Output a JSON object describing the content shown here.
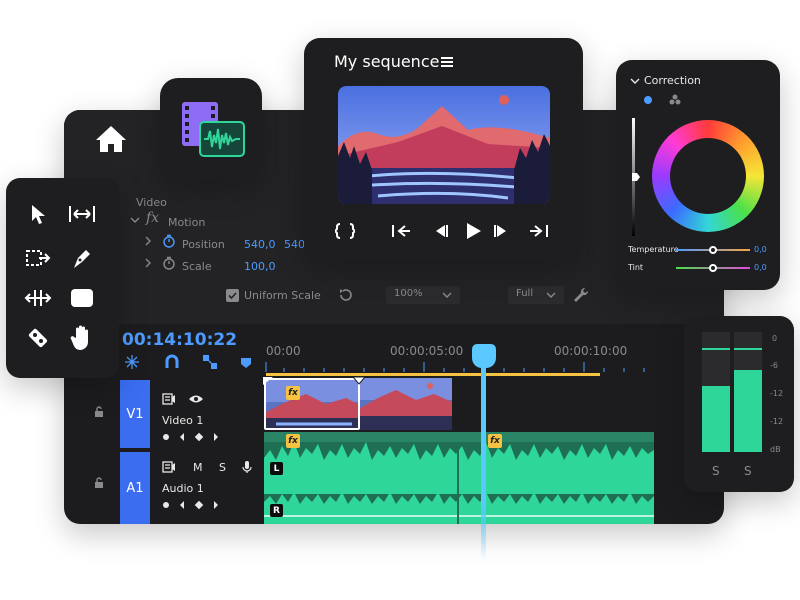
{
  "effects": {
    "section": "Video",
    "fx_label": "fx",
    "motion_label": "Motion",
    "position_label": "Position",
    "position_x": "540,0",
    "position_y": "540,",
    "scale_label": "Scale",
    "scale_value": "100,0",
    "uniform_scale_label": "Uniform Scale",
    "zoom_value": "100%",
    "quality_value": "Full"
  },
  "timeline": {
    "timecode": "00:14:10:22",
    "ruler_ticks": [
      "00:00",
      "00:00:05:00",
      "00:00:10:00"
    ],
    "tracks": [
      {
        "id": "V1",
        "name": "Video 1"
      },
      {
        "id": "A1",
        "name": "Audio 1",
        "mute": "M",
        "solo": "S"
      }
    ],
    "fx_badge": "fx",
    "channel_left": "L",
    "channel_right": "R"
  },
  "preview": {
    "title": "My sequence"
  },
  "correction": {
    "title": "Correction",
    "temperature_label": "Temperature",
    "temperature_value": "0,0",
    "tint_label": "Tint",
    "tint_value": "0,0"
  },
  "meter": {
    "scale": [
      "0",
      "-6",
      "-12",
      "-12",
      "dB"
    ],
    "solo_left": "S",
    "solo_right": "S",
    "levels": [
      0.55,
      0.68
    ]
  },
  "colors": {
    "accent_blue": "#3a6df0",
    "playhead": "#5bc8ff",
    "audio_green": "#2fd69a",
    "fx_yellow": "#f5c242",
    "timecode_blue": "#4d9bff"
  },
  "icons": {
    "home": "home-icon",
    "app": "film-audio-icon",
    "tools": [
      "select-arrow-icon",
      "track-select-icon",
      "ripple-edit-icon",
      "pen-icon",
      "slip-icon",
      "rectangle-icon",
      "razor-icon",
      "hand-icon"
    ]
  }
}
